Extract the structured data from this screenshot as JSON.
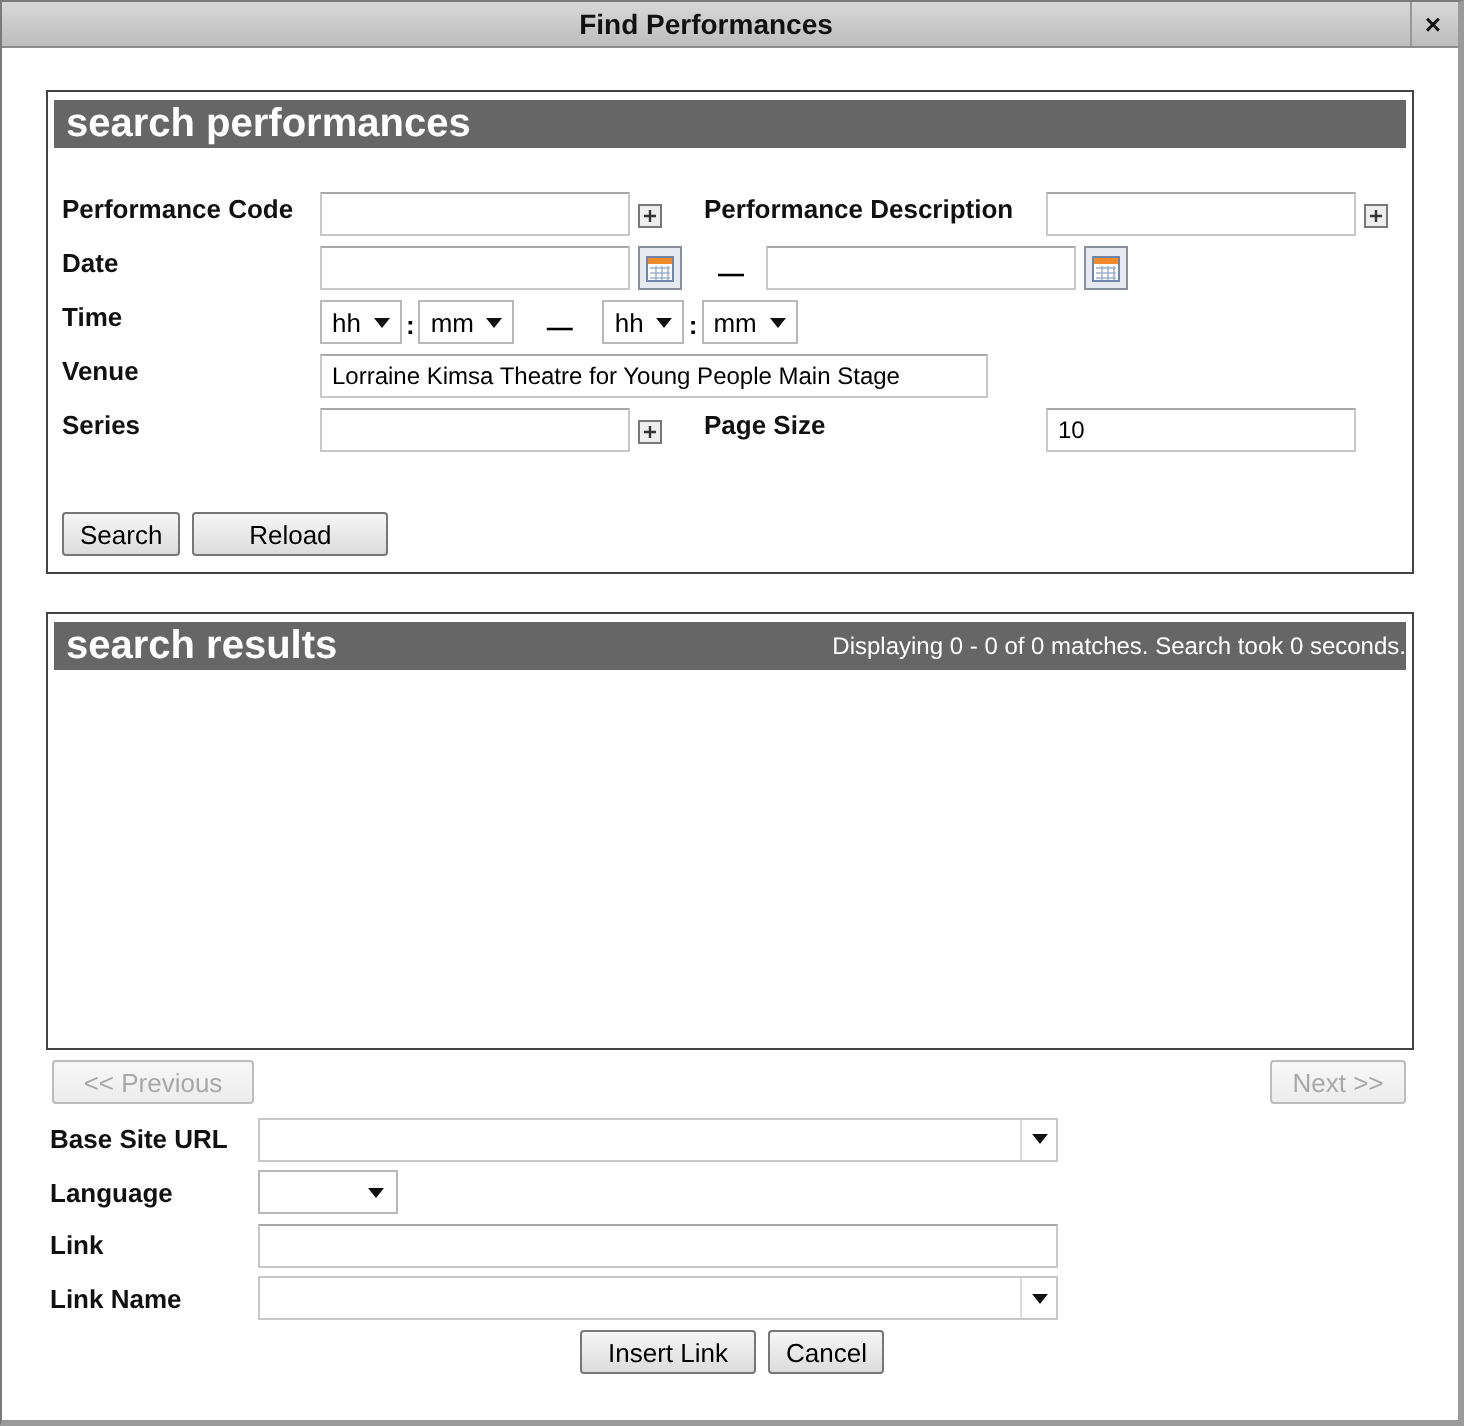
{
  "window": {
    "title": "Find Performances",
    "close": "×"
  },
  "search_panel": {
    "title": "search performances",
    "rows": [
      {
        "items": [
          {
            "kind": "lookup",
            "label": "Performance Code"
          },
          {
            "kind": "lookup",
            "label": "Performance Description"
          }
        ]
      },
      {
        "items": [
          {
            "kind": "date_range",
            "label": "Date",
            "separator": "—"
          }
        ]
      },
      {
        "items": [
          {
            "kind": "time_range",
            "label": "Time",
            "from_hour": "hh",
            "from_minute": "mm",
            "to_hour": "hh",
            "to_minute": "mm",
            "colon": ":",
            "separator": "—"
          }
        ]
      },
      {
        "items": [
          {
            "kind": "wide",
            "label": "Venue",
            "value": "Lorraine Kimsa Theatre for Young People Main Stage"
          }
        ]
      },
      {
        "items": [
          {
            "kind": "lookup",
            "label": "Series"
          },
          {
            "kind": "text",
            "label": "Page Size",
            "value": "10"
          }
        ]
      }
    ],
    "buttons": [
      {
        "label": "Search"
      },
      {
        "label": "Reload"
      }
    ]
  },
  "results_panel": {
    "title": "search results",
    "summary": "Displaying 0 - 0 of 0 matches. Search took 0 seconds."
  },
  "pager": [
    {
      "label": "<< Previous",
      "disabled": true
    },
    {
      "label": "Next >>",
      "disabled": true
    }
  ],
  "link_form": {
    "fields": [
      {
        "kind": "combo",
        "label": "Base Site URL"
      },
      {
        "kind": "select",
        "label": "Language"
      },
      {
        "kind": "text",
        "label": "Link"
      },
      {
        "kind": "combo",
        "label": "Link Name"
      }
    ],
    "buttons": [
      {
        "label": "Insert Link"
      },
      {
        "label": "Cancel"
      }
    ]
  }
}
